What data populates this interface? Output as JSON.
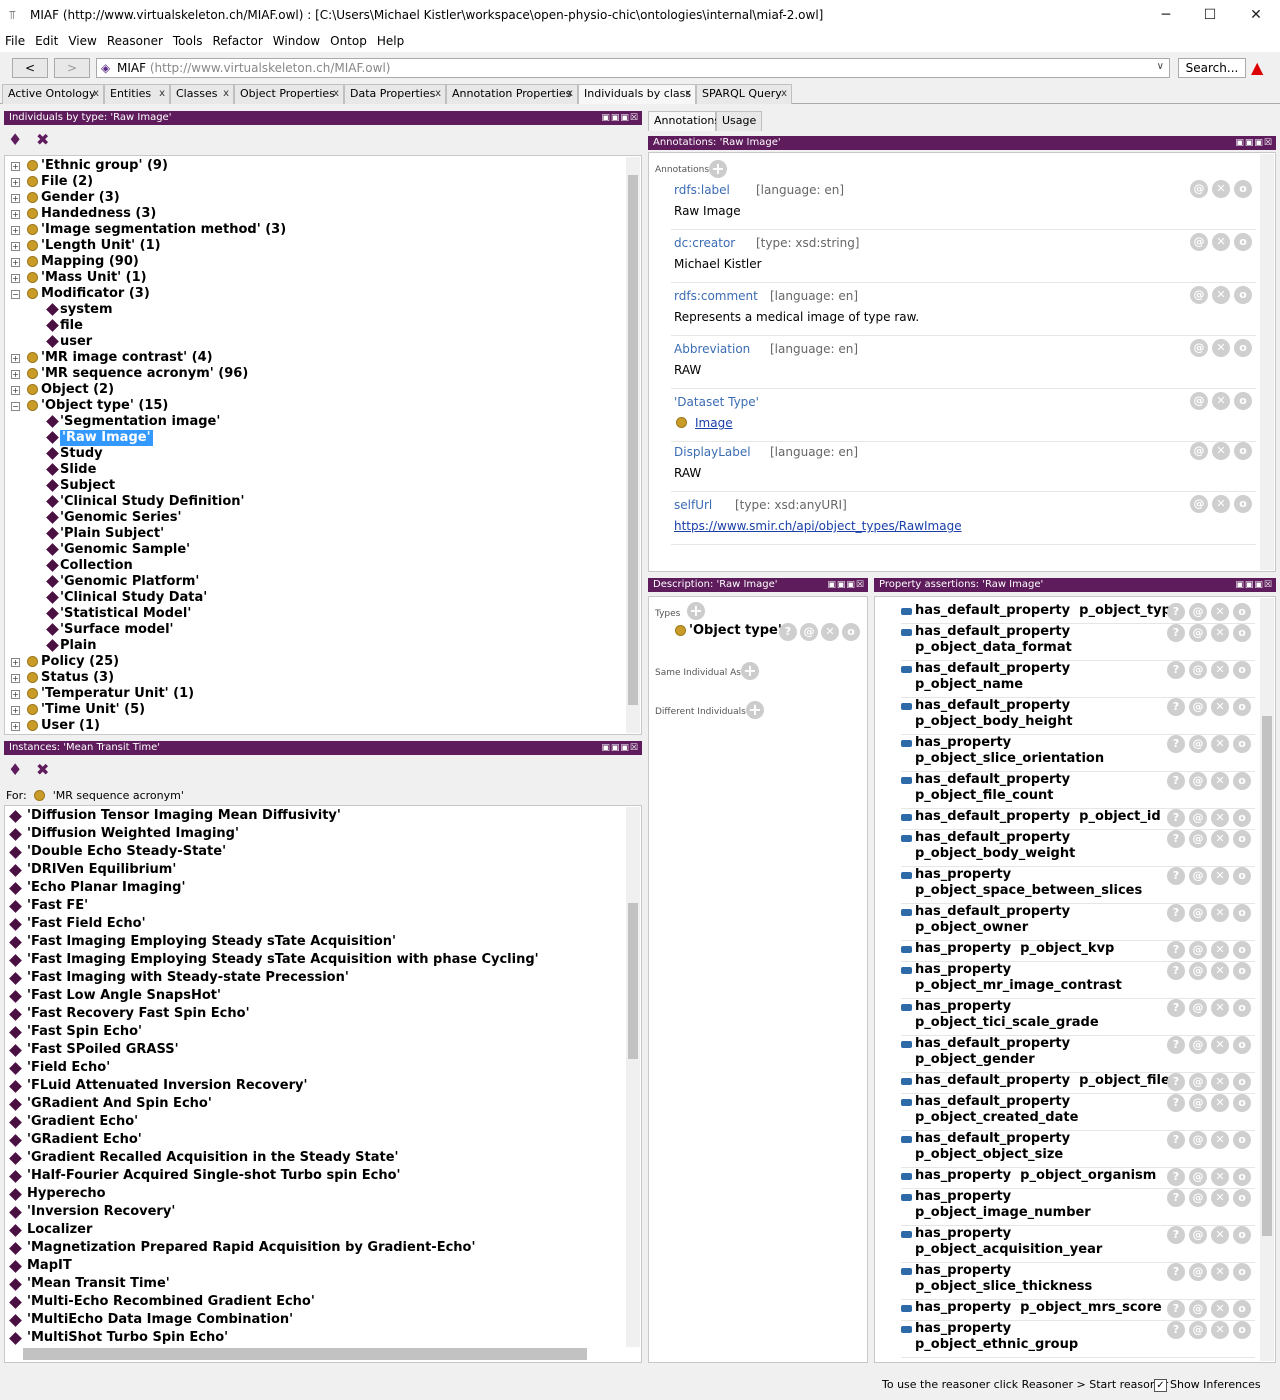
{
  "window": {
    "title": "MIAF (http://www.virtualskeleton.ch/MIAF.owl)  : [C:\\Users\\Michael Kistler\\workspace\\open-physio-chic\\ontologies\\internal\\miaf-2.owl]",
    "minimize": "─",
    "maximize": "☐",
    "close": "✕"
  },
  "menu": [
    "File",
    "Edit",
    "View",
    "Reasoner",
    "Tools",
    "Refactor",
    "Window",
    "Ontop",
    "Help"
  ],
  "toolbar": {
    "back": "<",
    "forward": ">",
    "ontology_name": "MIAF",
    "ontology_iri": "(http://www.virtualskeleton.ch/MIAF.owl)",
    "search_label": "Search..."
  },
  "tabs": [
    "Active Ontology",
    "Entities",
    "Classes",
    "Object Properties",
    "Data Properties",
    "Annotation Properties",
    "Individuals by class",
    "SPARQL Query"
  ],
  "tab_close": "x",
  "individuals_panel": {
    "title": "Individuals by type: 'Raw Image'",
    "tree": [
      {
        "label": "'Ethnic group' (9)",
        "kind": "class",
        "exp": "+"
      },
      {
        "label": "File (2)",
        "kind": "class",
        "exp": "+"
      },
      {
        "label": "Gender (3)",
        "kind": "class",
        "exp": "+"
      },
      {
        "label": "Handedness (3)",
        "kind": "class",
        "exp": "+"
      },
      {
        "label": "'Image segmentation method' (3)",
        "kind": "class",
        "exp": "+"
      },
      {
        "label": "'Length Unit' (1)",
        "kind": "class",
        "exp": "+"
      },
      {
        "label": "Mapping (90)",
        "kind": "class",
        "exp": "+"
      },
      {
        "label": "'Mass Unit' (1)",
        "kind": "class",
        "exp": "+"
      },
      {
        "label": "Modificator (3)",
        "kind": "class",
        "exp": "−"
      },
      {
        "label": "system",
        "kind": "ind"
      },
      {
        "label": "file",
        "kind": "ind"
      },
      {
        "label": "user",
        "kind": "ind"
      },
      {
        "label": "'MR image contrast' (4)",
        "kind": "class",
        "exp": "+"
      },
      {
        "label": "'MR sequence acronym' (96)",
        "kind": "class",
        "exp": "+"
      },
      {
        "label": "Object (2)",
        "kind": "class",
        "exp": "+"
      },
      {
        "label": "'Object type' (15)",
        "kind": "class",
        "exp": "−"
      },
      {
        "label": "'Segmentation image'",
        "kind": "ind"
      },
      {
        "label": "'Raw Image'",
        "kind": "ind",
        "selected": true
      },
      {
        "label": "Study",
        "kind": "ind"
      },
      {
        "label": "Slide",
        "kind": "ind"
      },
      {
        "label": "Subject",
        "kind": "ind"
      },
      {
        "label": "'Clinical Study Definition'",
        "kind": "ind"
      },
      {
        "label": "'Genomic Series'",
        "kind": "ind"
      },
      {
        "label": "'Plain Subject'",
        "kind": "ind"
      },
      {
        "label": "'Genomic Sample'",
        "kind": "ind"
      },
      {
        "label": "Collection",
        "kind": "ind"
      },
      {
        "label": "'Genomic Platform'",
        "kind": "ind"
      },
      {
        "label": "'Clinical Study Data'",
        "kind": "ind"
      },
      {
        "label": "'Statistical Model'",
        "kind": "ind"
      },
      {
        "label": "'Surface model'",
        "kind": "ind"
      },
      {
        "label": "Plain",
        "kind": "ind"
      },
      {
        "label": "Policy (25)",
        "kind": "class",
        "exp": "+"
      },
      {
        "label": "Status (3)",
        "kind": "class",
        "exp": "+"
      },
      {
        "label": "'Temperatur Unit' (1)",
        "kind": "class",
        "exp": "+"
      },
      {
        "label": "'Time Unit' (5)",
        "kind": "class",
        "exp": "+"
      },
      {
        "label": "User (1)",
        "kind": "class",
        "exp": "+"
      }
    ]
  },
  "instances_panel": {
    "title": "Instances: 'Mean Transit Time'",
    "for_label": "For:",
    "for_value": "'MR sequence acronym'",
    "items": [
      "'Diffusion Tensor Imaging Mean Diffusivity'",
      "'Diffusion Weighted Imaging'",
      "'Double Echo Steady-State'",
      "'DRIVen Equilibrium'",
      "'Echo Planar Imaging'",
      "'Fast FE'",
      "'Fast Field Echo'",
      "'Fast Imaging Employing Steady sTate Acquisition'",
      "'Fast Imaging Employing Steady sTate Acquisition with phase Cycling'",
      "'Fast Imaging with Steady-state Precession'",
      "'Fast Low Angle SnapsHot'",
      "'Fast Recovery Fast Spin Echo'",
      "'Fast Spin Echo'",
      "'Fast SPoiled GRASS'",
      "'Field Echo'",
      "'FLuid Attenuated Inversion Recovery'",
      "'GRadient And Spin Echo'",
      "'Gradient Echo'",
      "'GRadient Echo'",
      "'Gradient Recalled Acquisition in the Steady State'",
      "'Half-Fourier Acquired Single-shot Turbo spin Echo'",
      "Hyperecho",
      "'Inversion Recovery'",
      "Localizer",
      "'Magnetization Prepared Rapid Acquisition by Gradient-Echo'",
      "MapIT",
      "'Mean Transit Time'",
      "'Multi-Echo Recombined Gradient Echo'",
      "'MultiEcho Data Image Combination'",
      "'MultiShot Turbo Spin Echo'"
    ]
  },
  "annotation_tabs": [
    "Annotations",
    "Usage"
  ],
  "annotations_panel": {
    "title": "Annotations: 'Raw Image'",
    "header": "Annotations",
    "entries": [
      {
        "prop": "rdfs:label",
        "meta": "[language: en]",
        "value": "Raw Image",
        "link": false
      },
      {
        "prop": "dc:creator",
        "meta": "[type: xsd:string]",
        "value": "Michael Kistler",
        "link": false
      },
      {
        "prop": "rdfs:comment",
        "meta": "[language: en]",
        "value": "Represents a medical image of type raw.",
        "link": false
      },
      {
        "prop": "Abbreviation",
        "meta": "[language: en]",
        "value": "RAW",
        "link": false
      },
      {
        "prop": "'Dataset Type'",
        "meta": "",
        "value": "Image",
        "link": true,
        "class_icon": true
      },
      {
        "prop": "DisplayLabel",
        "meta": "[language: en]",
        "value": "RAW",
        "link": false
      },
      {
        "prop": "selfUrl",
        "meta": "[type: xsd:anyURI]",
        "value": "https://www.smir.ch/api/object_types/RawImage",
        "link": true
      }
    ]
  },
  "description_panel": {
    "title": "Description: 'Raw Image'",
    "types_label": "Types",
    "type_value": "'Object type'",
    "same_label": "Same Individual As",
    "different_label": "Different Individuals"
  },
  "property_panel": {
    "title": "Property assertions: 'Raw Image'",
    "rows": [
      [
        "has_default_property  p_object_type"
      ],
      [
        "has_default_property",
        "p_object_data_format"
      ],
      [
        "has_default_property",
        "p_object_name"
      ],
      [
        "has_default_property",
        "p_object_body_height"
      ],
      [
        "has_property",
        "p_object_slice_orientation"
      ],
      [
        "has_default_property",
        "p_object_file_count"
      ],
      [
        "has_default_property  p_object_id"
      ],
      [
        "has_default_property",
        "p_object_body_weight"
      ],
      [
        "has_property",
        "p_object_space_between_slices"
      ],
      [
        "has_default_property",
        "p_object_owner"
      ],
      [
        "has_property  p_object_kvp"
      ],
      [
        "has_property",
        "p_object_mr_image_contrast"
      ],
      [
        "has_property",
        "p_object_tici_scale_grade"
      ],
      [
        "has_default_property",
        "p_object_gender"
      ],
      [
        "has_default_property  p_object_file"
      ],
      [
        "has_default_property",
        "p_object_created_date"
      ],
      [
        "has_default_property",
        "p_object_object_size"
      ],
      [
        "has_property  p_object_organism"
      ],
      [
        "has_property",
        "p_object_image_number"
      ],
      [
        "has_property",
        "p_object_acquisition_year"
      ],
      [
        "has_property",
        "p_object_slice_thickness"
      ],
      [
        "has_property  p_object_mrs_score"
      ],
      [
        "has_property",
        "p_object_ethnic_group"
      ]
    ]
  },
  "buttons": {
    "info": "?",
    "annot": "@",
    "remove": "✕",
    "edit": "o",
    "add": "+"
  },
  "status": {
    "reasoner_hint": "To use the reasoner click Reasoner > Start reasoner",
    "show_inferences": "Show Inferences"
  }
}
